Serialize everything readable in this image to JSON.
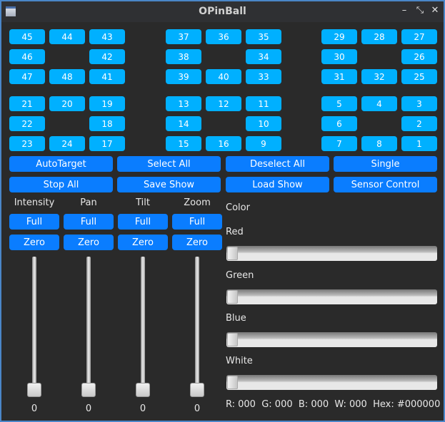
{
  "window": {
    "title": "OPinBall",
    "minimize": "–",
    "maximize": "⤡",
    "close": "✕"
  },
  "target_grid": [
    [
      "45",
      "44",
      "43",
      "37",
      "36",
      "35",
      "29",
      "28",
      "27"
    ],
    [
      "46",
      null,
      "42",
      "38",
      null,
      "34",
      "30",
      null,
      "26"
    ],
    [
      "47",
      "48",
      "41",
      "39",
      "40",
      "33",
      "31",
      "32",
      "25"
    ],
    [
      "21",
      "20",
      "19",
      "13",
      "12",
      "11",
      "5",
      "4",
      "3"
    ],
    [
      "22",
      null,
      "18",
      "14",
      null,
      "10",
      "6",
      null,
      "2"
    ],
    [
      "23",
      "24",
      "17",
      "15",
      "16",
      "9",
      "7",
      "8",
      "1"
    ]
  ],
  "actions": [
    [
      "AutoTarget",
      "Select All",
      "Deselect All",
      "Single"
    ],
    [
      "Stop All",
      "Save Show",
      "Load Show",
      "Sensor Control"
    ]
  ],
  "channels": [
    {
      "label": "Intensity",
      "full": "Full",
      "zero": "Zero",
      "value": "0"
    },
    {
      "label": "Pan",
      "full": "Full",
      "zero": "Zero",
      "value": "0"
    },
    {
      "label": "Tilt",
      "full": "Full",
      "zero": "Zero",
      "value": "0"
    },
    {
      "label": "Zoom",
      "full": "Full",
      "zero": "Zero",
      "value": "0"
    }
  ],
  "color": {
    "title": "Color",
    "sliders": [
      {
        "label": "Red",
        "value": 0
      },
      {
        "label": "Green",
        "value": 0
      },
      {
        "label": "Blue",
        "value": 0
      },
      {
        "label": "White",
        "value": 0
      }
    ],
    "status": "R: 000  G: 000  B: 000  W: 000  Hex: #000000"
  }
}
